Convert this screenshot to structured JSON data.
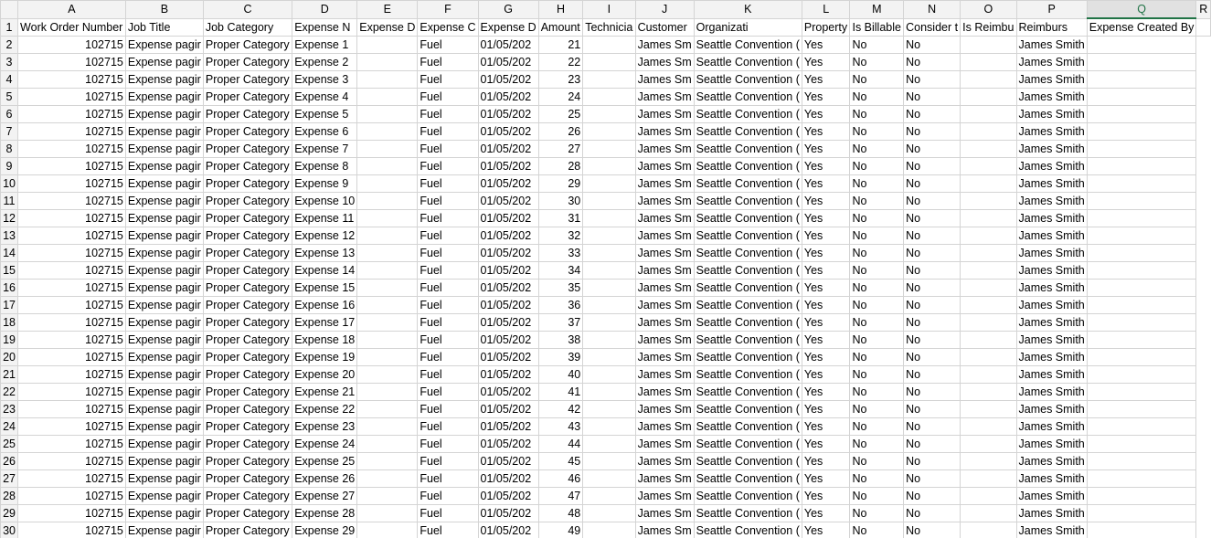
{
  "columns": [
    "A",
    "B",
    "C",
    "D",
    "E",
    "F",
    "G",
    "H",
    "I",
    "J",
    "K",
    "L",
    "M",
    "N",
    "O",
    "P",
    "Q",
    "R"
  ],
  "active_column": "Q",
  "header_row": [
    "Work Order Number",
    "Job Title",
    "Job Category",
    "Expense N",
    "Expense D",
    "Expense C",
    "Expense D",
    "Amount",
    "Technicia",
    "Customer",
    "Organizati",
    "Property",
    "Is Billable",
    "Consider t",
    "Is Reimbu",
    "Reimburs",
    "Expense Created By",
    ""
  ],
  "rows": [
    {
      "n": "2",
      "c": [
        "102715",
        "Expense pagir",
        "Proper Category",
        "Expense 1",
        "",
        "Fuel",
        "01/05/202",
        "21",
        "",
        "James Sm",
        "Seattle Convention (",
        "Yes",
        "No",
        "No",
        "",
        "James Smith",
        ""
      ]
    },
    {
      "n": "3",
      "c": [
        "102715",
        "Expense pagir",
        "Proper Category",
        "Expense 2",
        "",
        "Fuel",
        "01/05/202",
        "22",
        "",
        "James Sm",
        "Seattle Convention (",
        "Yes",
        "No",
        "No",
        "",
        "James Smith",
        ""
      ]
    },
    {
      "n": "4",
      "c": [
        "102715",
        "Expense pagir",
        "Proper Category",
        "Expense 3",
        "",
        "Fuel",
        "01/05/202",
        "23",
        "",
        "James Sm",
        "Seattle Convention (",
        "Yes",
        "No",
        "No",
        "",
        "James Smith",
        ""
      ]
    },
    {
      "n": "5",
      "c": [
        "102715",
        "Expense pagir",
        "Proper Category",
        "Expense 4",
        "",
        "Fuel",
        "01/05/202",
        "24",
        "",
        "James Sm",
        "Seattle Convention (",
        "Yes",
        "No",
        "No",
        "",
        "James Smith",
        ""
      ]
    },
    {
      "n": "6",
      "c": [
        "102715",
        "Expense pagir",
        "Proper Category",
        "Expense 5",
        "",
        "Fuel",
        "01/05/202",
        "25",
        "",
        "James Sm",
        "Seattle Convention (",
        "Yes",
        "No",
        "No",
        "",
        "James Smith",
        ""
      ]
    },
    {
      "n": "7",
      "c": [
        "102715",
        "Expense pagir",
        "Proper Category",
        "Expense 6",
        "",
        "Fuel",
        "01/05/202",
        "26",
        "",
        "James Sm",
        "Seattle Convention (",
        "Yes",
        "No",
        "No",
        "",
        "James Smith",
        ""
      ]
    },
    {
      "n": "8",
      "c": [
        "102715",
        "Expense pagir",
        "Proper Category",
        "Expense 7",
        "",
        "Fuel",
        "01/05/202",
        "27",
        "",
        "James Sm",
        "Seattle Convention (",
        "Yes",
        "No",
        "No",
        "",
        "James Smith",
        ""
      ]
    },
    {
      "n": "9",
      "c": [
        "102715",
        "Expense pagir",
        "Proper Category",
        "Expense 8",
        "",
        "Fuel",
        "01/05/202",
        "28",
        "",
        "James Sm",
        "Seattle Convention (",
        "Yes",
        "No",
        "No",
        "",
        "James Smith",
        ""
      ]
    },
    {
      "n": "10",
      "c": [
        "102715",
        "Expense pagir",
        "Proper Category",
        "Expense 9",
        "",
        "Fuel",
        "01/05/202",
        "29",
        "",
        "James Sm",
        "Seattle Convention (",
        "Yes",
        "No",
        "No",
        "",
        "James Smith",
        ""
      ]
    },
    {
      "n": "11",
      "c": [
        "102715",
        "Expense pagir",
        "Proper Category",
        "Expense 10",
        "",
        "Fuel",
        "01/05/202",
        "30",
        "",
        "James Sm",
        "Seattle Convention (",
        "Yes",
        "No",
        "No",
        "",
        "James Smith",
        ""
      ]
    },
    {
      "n": "12",
      "c": [
        "102715",
        "Expense pagir",
        "Proper Category",
        "Expense 11",
        "",
        "Fuel",
        "01/05/202",
        "31",
        "",
        "James Sm",
        "Seattle Convention (",
        "Yes",
        "No",
        "No",
        "",
        "James Smith",
        ""
      ]
    },
    {
      "n": "13",
      "c": [
        "102715",
        "Expense pagir",
        "Proper Category",
        "Expense 12",
        "",
        "Fuel",
        "01/05/202",
        "32",
        "",
        "James Sm",
        "Seattle Convention (",
        "Yes",
        "No",
        "No",
        "",
        "James Smith",
        ""
      ]
    },
    {
      "n": "14",
      "c": [
        "102715",
        "Expense pagir",
        "Proper Category",
        "Expense 13",
        "",
        "Fuel",
        "01/05/202",
        "33",
        "",
        "James Sm",
        "Seattle Convention (",
        "Yes",
        "No",
        "No",
        "",
        "James Smith",
        ""
      ]
    },
    {
      "n": "15",
      "c": [
        "102715",
        "Expense pagir",
        "Proper Category",
        "Expense 14",
        "",
        "Fuel",
        "01/05/202",
        "34",
        "",
        "James Sm",
        "Seattle Convention (",
        "Yes",
        "No",
        "No",
        "",
        "James Smith",
        ""
      ]
    },
    {
      "n": "16",
      "c": [
        "102715",
        "Expense pagir",
        "Proper Category",
        "Expense 15",
        "",
        "Fuel",
        "01/05/202",
        "35",
        "",
        "James Sm",
        "Seattle Convention (",
        "Yes",
        "No",
        "No",
        "",
        "James Smith",
        ""
      ]
    },
    {
      "n": "17",
      "c": [
        "102715",
        "Expense pagir",
        "Proper Category",
        "Expense 16",
        "",
        "Fuel",
        "01/05/202",
        "36",
        "",
        "James Sm",
        "Seattle Convention (",
        "Yes",
        "No",
        "No",
        "",
        "James Smith",
        ""
      ]
    },
    {
      "n": "18",
      "c": [
        "102715",
        "Expense pagir",
        "Proper Category",
        "Expense 17",
        "",
        "Fuel",
        "01/05/202",
        "37",
        "",
        "James Sm",
        "Seattle Convention (",
        "Yes",
        "No",
        "No",
        "",
        "James Smith",
        ""
      ]
    },
    {
      "n": "19",
      "c": [
        "102715",
        "Expense pagir",
        "Proper Category",
        "Expense 18",
        "",
        "Fuel",
        "01/05/202",
        "38",
        "",
        "James Sm",
        "Seattle Convention (",
        "Yes",
        "No",
        "No",
        "",
        "James Smith",
        ""
      ]
    },
    {
      "n": "20",
      "c": [
        "102715",
        "Expense pagir",
        "Proper Category",
        "Expense 19",
        "",
        "Fuel",
        "01/05/202",
        "39",
        "",
        "James Sm",
        "Seattle Convention (",
        "Yes",
        "No",
        "No",
        "",
        "James Smith",
        ""
      ]
    },
    {
      "n": "21",
      "c": [
        "102715",
        "Expense pagir",
        "Proper Category",
        "Expense 20",
        "",
        "Fuel",
        "01/05/202",
        "40",
        "",
        "James Sm",
        "Seattle Convention (",
        "Yes",
        "No",
        "No",
        "",
        "James Smith",
        ""
      ]
    },
    {
      "n": "22",
      "c": [
        "102715",
        "Expense pagir",
        "Proper Category",
        "Expense 21",
        "",
        "Fuel",
        "01/05/202",
        "41",
        "",
        "James Sm",
        "Seattle Convention (",
        "Yes",
        "No",
        "No",
        "",
        "James Smith",
        ""
      ]
    },
    {
      "n": "23",
      "c": [
        "102715",
        "Expense pagir",
        "Proper Category",
        "Expense 22",
        "",
        "Fuel",
        "01/05/202",
        "42",
        "",
        "James Sm",
        "Seattle Convention (",
        "Yes",
        "No",
        "No",
        "",
        "James Smith",
        ""
      ]
    },
    {
      "n": "24",
      "c": [
        "102715",
        "Expense pagir",
        "Proper Category",
        "Expense 23",
        "",
        "Fuel",
        "01/05/202",
        "43",
        "",
        "James Sm",
        "Seattle Convention (",
        "Yes",
        "No",
        "No",
        "",
        "James Smith",
        ""
      ]
    },
    {
      "n": "25",
      "c": [
        "102715",
        "Expense pagir",
        "Proper Category",
        "Expense 24",
        "",
        "Fuel",
        "01/05/202",
        "44",
        "",
        "James Sm",
        "Seattle Convention (",
        "Yes",
        "No",
        "No",
        "",
        "James Smith",
        ""
      ]
    },
    {
      "n": "26",
      "c": [
        "102715",
        "Expense pagir",
        "Proper Category",
        "Expense 25",
        "",
        "Fuel",
        "01/05/202",
        "45",
        "",
        "James Sm",
        "Seattle Convention (",
        "Yes",
        "No",
        "No",
        "",
        "James Smith",
        ""
      ]
    },
    {
      "n": "27",
      "c": [
        "102715",
        "Expense pagir",
        "Proper Category",
        "Expense 26",
        "",
        "Fuel",
        "01/05/202",
        "46",
        "",
        "James Sm",
        "Seattle Convention (",
        "Yes",
        "No",
        "No",
        "",
        "James Smith",
        ""
      ]
    },
    {
      "n": "28",
      "c": [
        "102715",
        "Expense pagir",
        "Proper Category",
        "Expense 27",
        "",
        "Fuel",
        "01/05/202",
        "47",
        "",
        "James Sm",
        "Seattle Convention (",
        "Yes",
        "No",
        "No",
        "",
        "James Smith",
        ""
      ]
    },
    {
      "n": "29",
      "c": [
        "102715",
        "Expense pagir",
        "Proper Category",
        "Expense 28",
        "",
        "Fuel",
        "01/05/202",
        "48",
        "",
        "James Sm",
        "Seattle Convention (",
        "Yes",
        "No",
        "No",
        "",
        "James Smith",
        ""
      ]
    },
    {
      "n": "30",
      "c": [
        "102715",
        "Expense pagir",
        "Proper Category",
        "Expense 29",
        "",
        "Fuel",
        "01/05/202",
        "49",
        "",
        "James Sm",
        "Seattle Convention (",
        "Yes",
        "No",
        "No",
        "",
        "James Smith",
        ""
      ]
    }
  ]
}
